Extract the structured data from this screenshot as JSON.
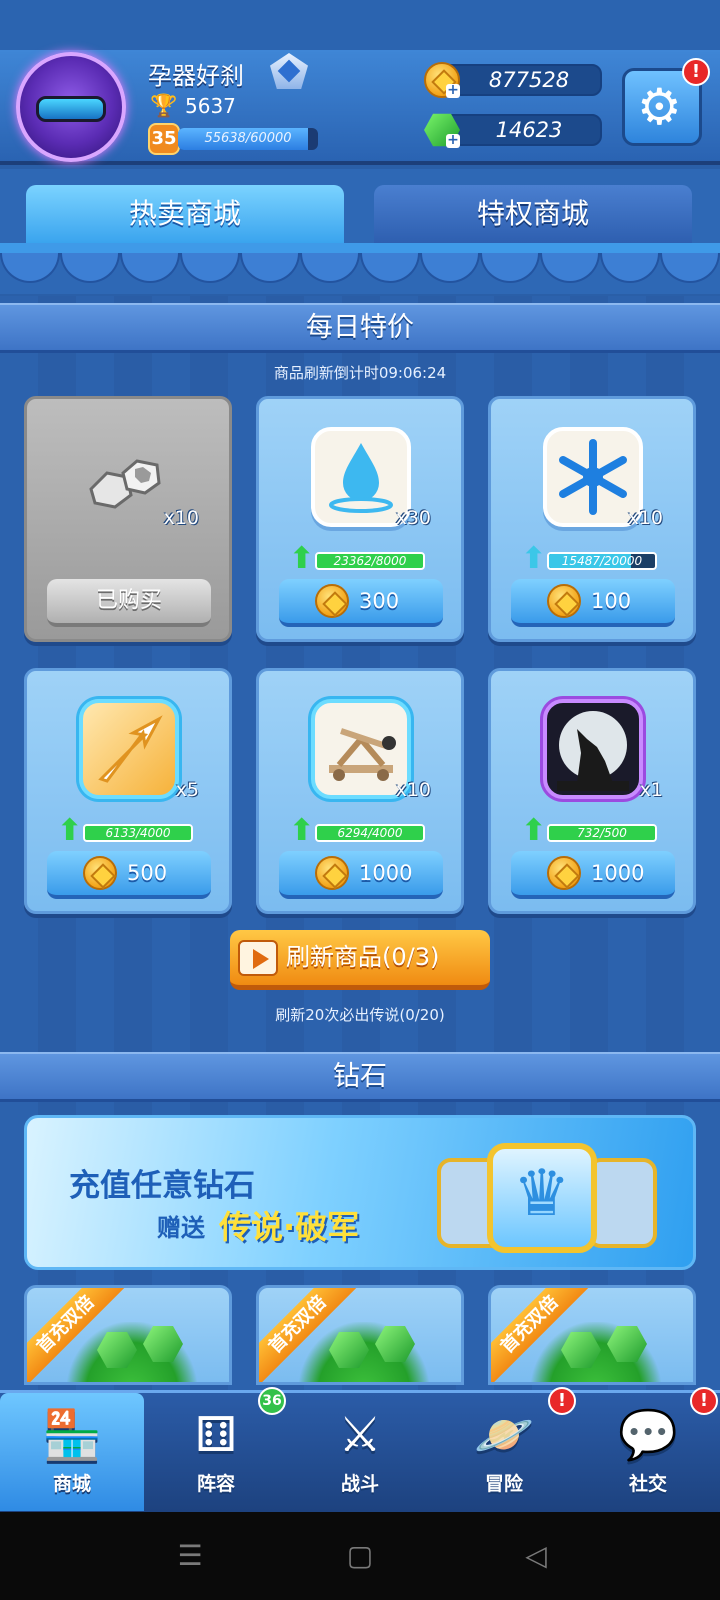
{
  "header": {
    "player_name": "孕器好刹",
    "trophies": "5637",
    "level": "35",
    "xp_text": "55638/60000",
    "xp_progress": 0.927,
    "gold": "877528",
    "gems": "14623",
    "settings_badge": "!"
  },
  "tabs": [
    {
      "label": "热卖商城",
      "active": true
    },
    {
      "label": "特权商城",
      "active": false
    }
  ],
  "daily": {
    "title": "每日特价",
    "refresh_timer": "商品刷新倒计时09:06:24",
    "items": [
      {
        "icon": "silver-hex-nuts-icon",
        "qty": "x10",
        "status": "已购买"
      },
      {
        "icon": "water-drop-icon",
        "qty": "x30",
        "progress_text": "23362/8000",
        "progress": 1.0,
        "price": "300"
      },
      {
        "icon": "snowflake-icon",
        "qty": "x10",
        "progress_text": "15487/20000",
        "progress": 0.774,
        "price": "100"
      },
      {
        "icon": "golden-arrow-icon",
        "qty": "x5",
        "progress_text": "6133/4000",
        "progress": 1.0,
        "price": "500"
      },
      {
        "icon": "catapult-icon",
        "qty": "x10",
        "progress_text": "6294/4000",
        "progress": 1.0,
        "price": "1000"
      },
      {
        "icon": "howling-wolf-icon",
        "qty": "x1",
        "progress_text": "732/500",
        "progress": 1.0,
        "price": "1000"
      }
    ],
    "refresh_button": "刷新商品(0/3)",
    "guarantee_text": "刷新20次必出传说(0/20)"
  },
  "diamonds": {
    "title": "钻石",
    "banner_line1": "充值任意钻石",
    "banner_gift": "赠送",
    "banner_highlight": "传说·破军",
    "ribbon": "首充双倍"
  },
  "nav": {
    "items": [
      {
        "label": "商城",
        "icon": "store-icon"
      },
      {
        "label": "阵容",
        "icon": "dice-icon",
        "badge": "36"
      },
      {
        "label": "战斗",
        "icon": "crossed-swords-icon"
      },
      {
        "label": "冒险",
        "icon": "planet-icon",
        "badge": "!"
      },
      {
        "label": "社交",
        "icon": "chat-bubbles-icon",
        "badge": "!"
      }
    ]
  },
  "colors": {
    "accent_blue": "#3aa4ee",
    "progress_green": "#2fd04b",
    "progress_cyan": "#3bc7e8",
    "refresh_orange": "#f08b12",
    "alert_red": "#e82828"
  }
}
